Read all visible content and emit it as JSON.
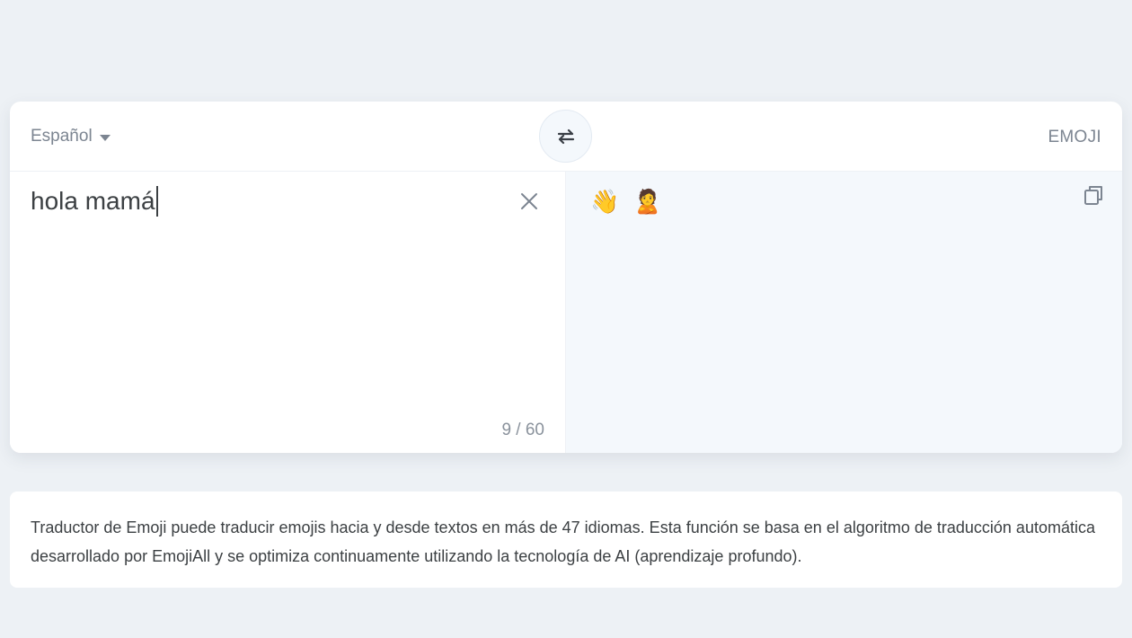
{
  "translator": {
    "source_language": "Español",
    "target_language": "EMOJI",
    "input_value": "hola mamá",
    "char_count": "9 / 60",
    "output_value": "👋 🙎"
  },
  "icons": {
    "language_dropdown": "caret-down-icon",
    "swap": "swap-arrows-icon",
    "clear": "close-icon",
    "copy": "copy-icon"
  },
  "info": {
    "description": "Traductor de Emoji puede traducir emojis hacia y desde textos en más de 47 idiomas. Esta función se basa en el algoritmo de traducción automática desarrollado por EmojiAll y se optimiza continuamente utilizando la tecnología de AI (aprendizaje profundo)."
  },
  "colors": {
    "page_background": "#edf1f5",
    "card_background": "#ffffff",
    "output_background": "#f4f8fc",
    "muted_text": "#7c8591",
    "primary_text": "#3c4043"
  }
}
